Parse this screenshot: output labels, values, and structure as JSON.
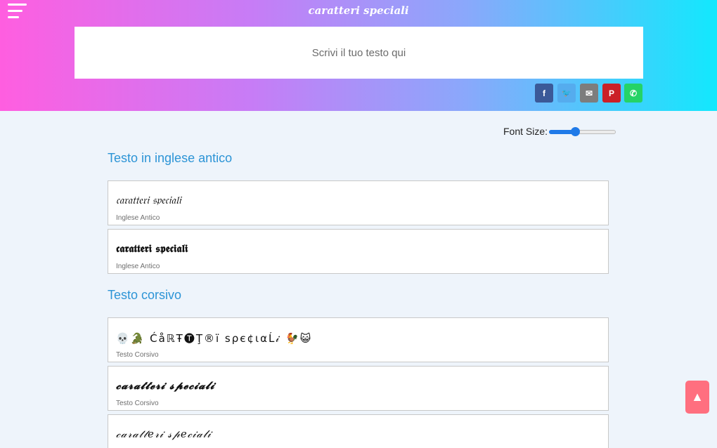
{
  "header": {
    "title": "caratteri speciali",
    "input_placeholder": "Scrivi il tuo testo qui"
  },
  "share": [
    {
      "icon": "facebook-icon",
      "glyph": "f",
      "color": "#3b5998"
    },
    {
      "icon": "twitter-icon",
      "glyph": "🐦",
      "color": "#55acee"
    },
    {
      "icon": "email-icon",
      "glyph": "✉",
      "color": "#7d7d7d"
    },
    {
      "icon": "pinterest-icon",
      "glyph": "P",
      "color": "#cb2027"
    },
    {
      "icon": "whatsapp-icon",
      "glyph": "✆",
      "color": "#25d366"
    }
  ],
  "font_size": {
    "label": "Font Size:",
    "value_fraction": 0.38
  },
  "sections": [
    {
      "title": "Testo in inglese antico",
      "cards": [
        {
          "text": "𝔠𝔞𝔯𝔞𝔱𝔱𝔢𝔯𝔦 𝔰𝔭𝔢𝔠𝔦𝔞𝔩𝔦",
          "label": "Inglese Antico"
        },
        {
          "text": "𝖈𝖆𝖗𝖆𝖙𝖙𝖊𝖗𝖎 𝖘𝖕𝖊𝖈𝖎𝖆𝖑𝖎",
          "label": "Inglese Antico"
        }
      ]
    },
    {
      "title": "Testo corsivo",
      "cards": [
        {
          "text": "💀🐊 ĆåℝŦ🅣Ţ®ï ѕρє¢ιαĹ𝒾 🐓😺",
          "label": "Testo Corsivo"
        },
        {
          "text": "𝓬𝓪𝓻𝓪𝓽𝓽𝓮𝓻𝓲 𝓼𝓹𝓮𝓬𝓲𝓪𝓵𝓲",
          "label": "Testo Corsivo"
        },
        {
          "text": "𝒸𝒶𝓇𝒶𝓉𝓉𝑒𝓇𝒾 𝓈𝓅𝑒𝒸𝒾𝒶𝓁𝒾",
          "label": ""
        }
      ]
    }
  ],
  "scroll_top": {
    "glyph": "▲"
  },
  "colors": {
    "gradient_start": "#ff5ee0",
    "gradient_end": "#12e8fd",
    "section_title": "#2c94d6",
    "accent": "#1f7ae8",
    "scroll_top_bg": "#ff6f7f"
  }
}
